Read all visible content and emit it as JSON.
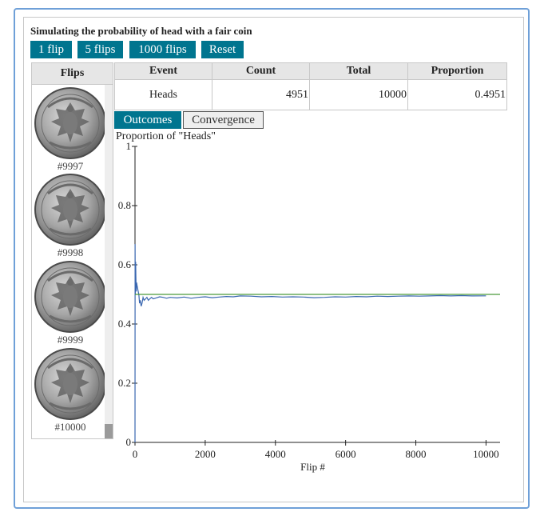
{
  "app": {
    "title": "Simulating the probability of head with a fair coin"
  },
  "buttons": [
    "1 flip",
    "5 flips",
    "1000 flips",
    "Reset"
  ],
  "flips_panel": {
    "header": "Flips",
    "items": [
      {
        "label": "#9997"
      },
      {
        "label": "#9998"
      },
      {
        "label": "#9999"
      },
      {
        "label": "#10000"
      }
    ]
  },
  "table": {
    "headers": [
      "Event",
      "Count",
      "Total",
      "Proportion"
    ],
    "rows": [
      [
        "Heads",
        "4951",
        "10000",
        "0.4951"
      ]
    ]
  },
  "tabs": {
    "outcomes": "Outcomes",
    "convergence": "Convergence"
  },
  "chart_data": {
    "type": "line",
    "title": "Proportion of \"Heads\"",
    "xlabel": "Flip #",
    "ylabel": "",
    "xlim": [
      0,
      10400
    ],
    "ylim": [
      0,
      1
    ],
    "xticks": [
      0,
      2000,
      4000,
      6000,
      8000,
      10000
    ],
    "yticks": [
      0,
      0.2,
      0.4,
      0.6,
      0.8,
      1
    ],
    "ytick_labels": [
      "0",
      "0.2",
      "0.4",
      "0.6",
      "0.8",
      "1"
    ],
    "series": [
      {
        "color": "#3a67b0",
        "x": [
          1,
          2,
          3,
          5,
          8,
          12,
          18,
          25,
          35,
          45,
          60,
          75,
          90,
          110,
          130,
          150,
          175,
          200,
          230,
          260,
          300,
          340,
          380,
          420,
          470,
          520,
          600,
          700,
          800,
          900,
          1000,
          1200,
          1400,
          1600,
          1800,
          2000,
          2200,
          2400,
          2600,
          2800,
          3000,
          3300,
          3600,
          3900,
          4200,
          4500,
          4800,
          5100,
          5400,
          5700,
          6000,
          6300,
          6600,
          6900,
          7200,
          7500,
          7800,
          8100,
          8400,
          8700,
          9000,
          9300,
          9600,
          10000
        ],
        "values": [
          0.0,
          0.5,
          0.67,
          0.6,
          0.5,
          0.58,
          0.61,
          0.56,
          0.51,
          0.54,
          0.53,
          0.52,
          0.51,
          0.5,
          0.47,
          0.48,
          0.46,
          0.47,
          0.49,
          0.48,
          0.485,
          0.49,
          0.48,
          0.485,
          0.49,
          0.485,
          0.488,
          0.492,
          0.49,
          0.487,
          0.49,
          0.488,
          0.491,
          0.487,
          0.49,
          0.492,
          0.489,
          0.491,
          0.493,
          0.492,
          0.495,
          0.494,
          0.492,
          0.493,
          0.491,
          0.492,
          0.491,
          0.489,
          0.49,
          0.492,
          0.491,
          0.493,
          0.492,
          0.494,
          0.493,
          0.494,
          0.495,
          0.494,
          0.495,
          0.496,
          0.495,
          0.496,
          0.495,
          0.4951
        ]
      },
      {
        "color": "#4a9a3a",
        "x": [
          1,
          10400
        ],
        "values": [
          0.5,
          0.5
        ]
      }
    ]
  }
}
